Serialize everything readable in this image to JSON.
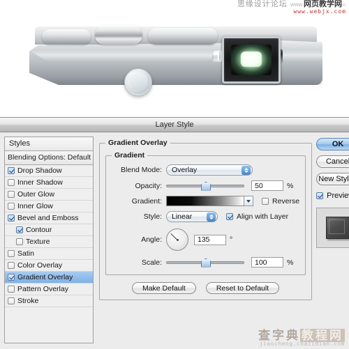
{
  "watermarks": {
    "top_cn": "思缘设计论坛",
    "top_www": "www.",
    "top_brand": "网页教学网",
    "top_suffix": "m",
    "top_url": "www.webjx.com",
    "bottom_cn1": "查字典",
    "bottom_cn2": "教程网",
    "bottom_url": "jiaocheng.chazidian.com"
  },
  "photo": {
    "alt": "silver-digital-camera-body"
  },
  "dialog": {
    "title": "Layer Style"
  },
  "styles_panel": {
    "header": "Styles",
    "blending_options": "Blending Options: Default",
    "items": [
      {
        "label": "Drop Shadow",
        "checked": true,
        "indent": false,
        "selected": false
      },
      {
        "label": "Inner Shadow",
        "checked": false,
        "indent": false,
        "selected": false
      },
      {
        "label": "Outer Glow",
        "checked": false,
        "indent": false,
        "selected": false
      },
      {
        "label": "Inner Glow",
        "checked": false,
        "indent": false,
        "selected": false
      },
      {
        "label": "Bevel and Emboss",
        "checked": true,
        "indent": false,
        "selected": false
      },
      {
        "label": "Contour",
        "checked": true,
        "indent": true,
        "selected": false
      },
      {
        "label": "Texture",
        "checked": false,
        "indent": true,
        "selected": false
      },
      {
        "label": "Satin",
        "checked": false,
        "indent": false,
        "selected": false
      },
      {
        "label": "Color Overlay",
        "checked": false,
        "indent": false,
        "selected": false
      },
      {
        "label": "Gradient Overlay",
        "checked": true,
        "indent": false,
        "selected": true
      },
      {
        "label": "Pattern Overlay",
        "checked": false,
        "indent": false,
        "selected": false
      },
      {
        "label": "Stroke",
        "checked": false,
        "indent": false,
        "selected": false
      }
    ]
  },
  "settings": {
    "section_title": "Gradient Overlay",
    "group_title": "Gradient",
    "blend_mode": {
      "label": "Blend Mode:",
      "value": "Overlay"
    },
    "opacity": {
      "label": "Opacity:",
      "value": "50",
      "unit": "%",
      "percent": 50
    },
    "gradient": {
      "label": "Gradient:",
      "swatch_from": "#000000",
      "swatch_to": "#ffffff"
    },
    "reverse": {
      "label": "Reverse",
      "checked": false
    },
    "style": {
      "label": "Style:",
      "value": "Linear"
    },
    "align_with_layer": {
      "label": "Align with Layer",
      "checked": true
    },
    "angle": {
      "label": "Angle:",
      "value": "135",
      "unit": "°",
      "degrees": 135
    },
    "scale": {
      "label": "Scale:",
      "value": "100",
      "unit": "%",
      "percent": 100
    },
    "make_default": "Make Default",
    "reset_to_default": "Reset to Default"
  },
  "buttons": {
    "ok": "OK",
    "cancel": "Cancel",
    "new_style": "New Style..",
    "preview_label": "Preview",
    "preview_checked": true
  },
  "colors": {
    "selection_blue": "#8fb9ea",
    "dialog_bg": "#ececec",
    "panel_border": "#a0a0a0",
    "accent_button": "#a9cdf2"
  }
}
